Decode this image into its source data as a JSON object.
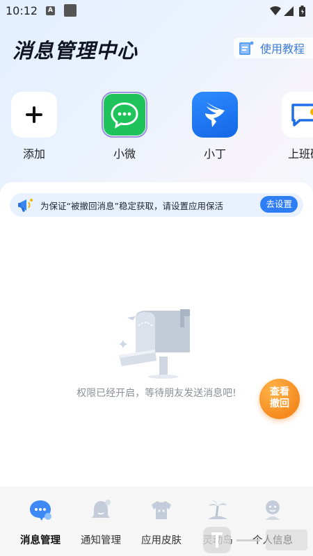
{
  "status_bar": {
    "time": "10:12",
    "a_badge": "A"
  },
  "header": {
    "title": "消息管理中心",
    "tutorial_label": "使用教程"
  },
  "apps": [
    {
      "label": "添加",
      "icon": "plus-icon"
    },
    {
      "label": "小微",
      "icon": "wechat-icon"
    },
    {
      "label": "小丁",
      "icon": "dingtalk-icon"
    },
    {
      "label": "上班研",
      "icon": "chat-bubble-icon"
    }
  ],
  "notice": {
    "text": "为保证“被撤回消息”稳定获取，请设置应用保活",
    "button_label": "去设置"
  },
  "empty_state": {
    "text": "权限已经开启，等待朋友发送消息吧!"
  },
  "fab": {
    "line1": "查看",
    "line2": "撤回"
  },
  "bottom_nav": [
    {
      "label": "消息管理",
      "icon": "message-icon",
      "active": true
    },
    {
      "label": "通知管理",
      "icon": "bell-icon",
      "active": false
    },
    {
      "label": "应用皮肤",
      "icon": "tshirt-icon",
      "active": false
    },
    {
      "label": "灵动岛",
      "icon": "island-icon",
      "active": false
    },
    {
      "label": "个人信息",
      "icon": "user-icon",
      "active": false
    }
  ],
  "colors": {
    "accent": "#2f7ef5",
    "wechat": "#1fc35b",
    "dingtalk": "#1677ff",
    "fab": "#f58a1f"
  }
}
